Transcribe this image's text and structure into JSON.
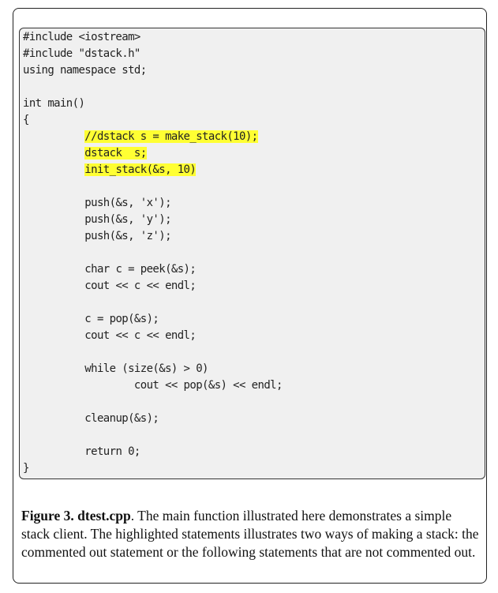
{
  "code_lines": [
    {
      "indent": "",
      "text": "#include <iostream>",
      "highlight": false
    },
    {
      "indent": "",
      "text": "#include \"dstack.h\"",
      "highlight": false
    },
    {
      "indent": "",
      "text": "using namespace std;",
      "highlight": false
    },
    {
      "indent": "",
      "text": "",
      "highlight": false
    },
    {
      "indent": "",
      "text": "int main()",
      "highlight": false
    },
    {
      "indent": "",
      "text": "{",
      "highlight": false
    },
    {
      "indent": "          ",
      "text": "//dstack s = make_stack(10);",
      "highlight": true
    },
    {
      "indent": "          ",
      "text": "dstack  s;",
      "highlight": true
    },
    {
      "indent": "          ",
      "text": "init_stack(&s, 10)",
      "highlight": true
    },
    {
      "indent": "",
      "text": "",
      "highlight": false
    },
    {
      "indent": "          ",
      "text": "push(&s, 'x');",
      "highlight": false
    },
    {
      "indent": "          ",
      "text": "push(&s, 'y');",
      "highlight": false
    },
    {
      "indent": "          ",
      "text": "push(&s, 'z');",
      "highlight": false
    },
    {
      "indent": "",
      "text": "",
      "highlight": false
    },
    {
      "indent": "          ",
      "text": "char c = peek(&s);",
      "highlight": false
    },
    {
      "indent": "          ",
      "text": "cout << c << endl;",
      "highlight": false
    },
    {
      "indent": "",
      "text": "",
      "highlight": false
    },
    {
      "indent": "          ",
      "text": "c = pop(&s);",
      "highlight": false
    },
    {
      "indent": "          ",
      "text": "cout << c << endl;",
      "highlight": false
    },
    {
      "indent": "",
      "text": "",
      "highlight": false
    },
    {
      "indent": "          ",
      "text": "while (size(&s) > 0)",
      "highlight": false
    },
    {
      "indent": "                  ",
      "text": "cout << pop(&s) << endl;",
      "highlight": false
    },
    {
      "indent": "",
      "text": "",
      "highlight": false
    },
    {
      "indent": "          ",
      "text": "cleanup(&s);",
      "highlight": false
    },
    {
      "indent": "",
      "text": "",
      "highlight": false
    },
    {
      "indent": "          ",
      "text": "return 0;",
      "highlight": false
    },
    {
      "indent": "",
      "text": "}",
      "highlight": false
    }
  ],
  "caption": {
    "title": "Figure 3. dtest.cpp",
    "body": ". The main function illustrated here demonstrates a simple stack client. The highlighted statements illustrates two ways of making a stack: the commented out statement or the following statements that are not commented out."
  },
  "colors": {
    "highlight": "#ffff33",
    "code_background": "#f0f0f0",
    "border": "#222222"
  }
}
